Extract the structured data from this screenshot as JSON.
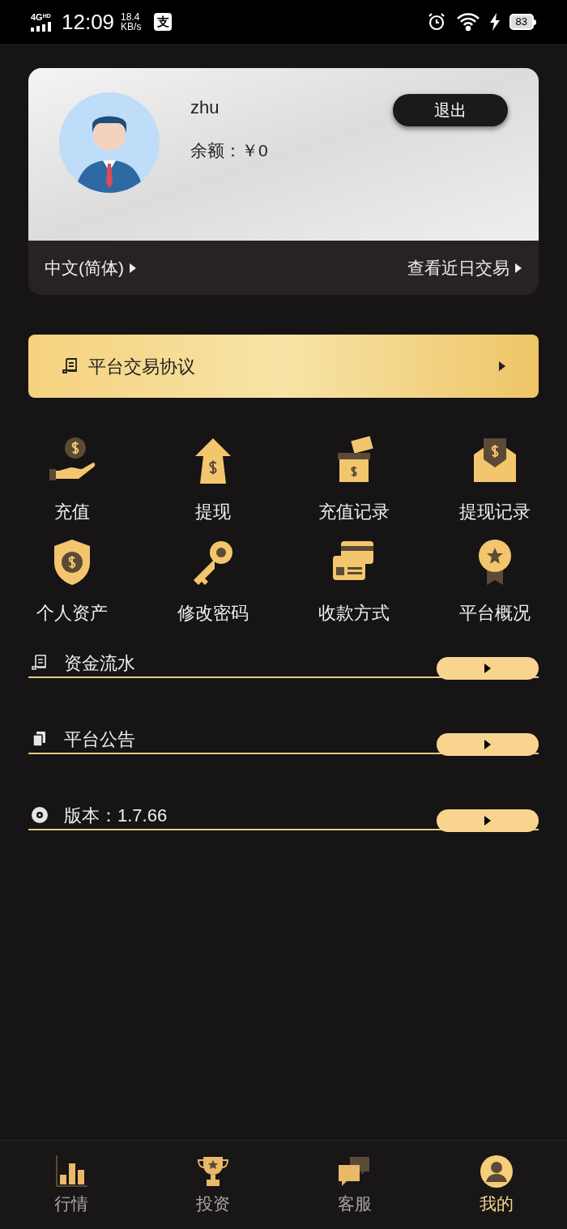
{
  "status_bar": {
    "network": "4G",
    "network_badge": "HD",
    "time": "12:09",
    "speed": "18.4",
    "speed_unit": "KB/s",
    "app_badge": "支",
    "battery": "83"
  },
  "profile": {
    "username": "zhu",
    "balance": "余额：￥0",
    "logout": "退出",
    "language": "中文(简体)",
    "recent": "查看近日交易"
  },
  "agreement": {
    "label": "平台交易协议"
  },
  "grid": [
    {
      "label": "充值",
      "kind": "hand"
    },
    {
      "label": "提现",
      "kind": "arrow"
    },
    {
      "label": "充值记录",
      "kind": "box"
    },
    {
      "label": "提现记录",
      "kind": "envelope"
    },
    {
      "label": "个人资产",
      "kind": "shield"
    },
    {
      "label": "修改密码",
      "kind": "key"
    },
    {
      "label": "收款方式",
      "kind": "card"
    },
    {
      "label": "平台概况",
      "kind": "medal"
    }
  ],
  "menu": [
    {
      "label": "资金流水",
      "kind": "receipt"
    },
    {
      "label": "平台公告",
      "kind": "docs"
    },
    {
      "label": "版本：1.7.66",
      "kind": "disc"
    }
  ],
  "tabs": [
    {
      "label": "行情",
      "kind": "chart",
      "selected": false
    },
    {
      "label": "投资",
      "kind": "trophy",
      "selected": false
    },
    {
      "label": "客服",
      "kind": "chat",
      "selected": false
    },
    {
      "label": "我的",
      "kind": "user",
      "selected": true
    }
  ]
}
